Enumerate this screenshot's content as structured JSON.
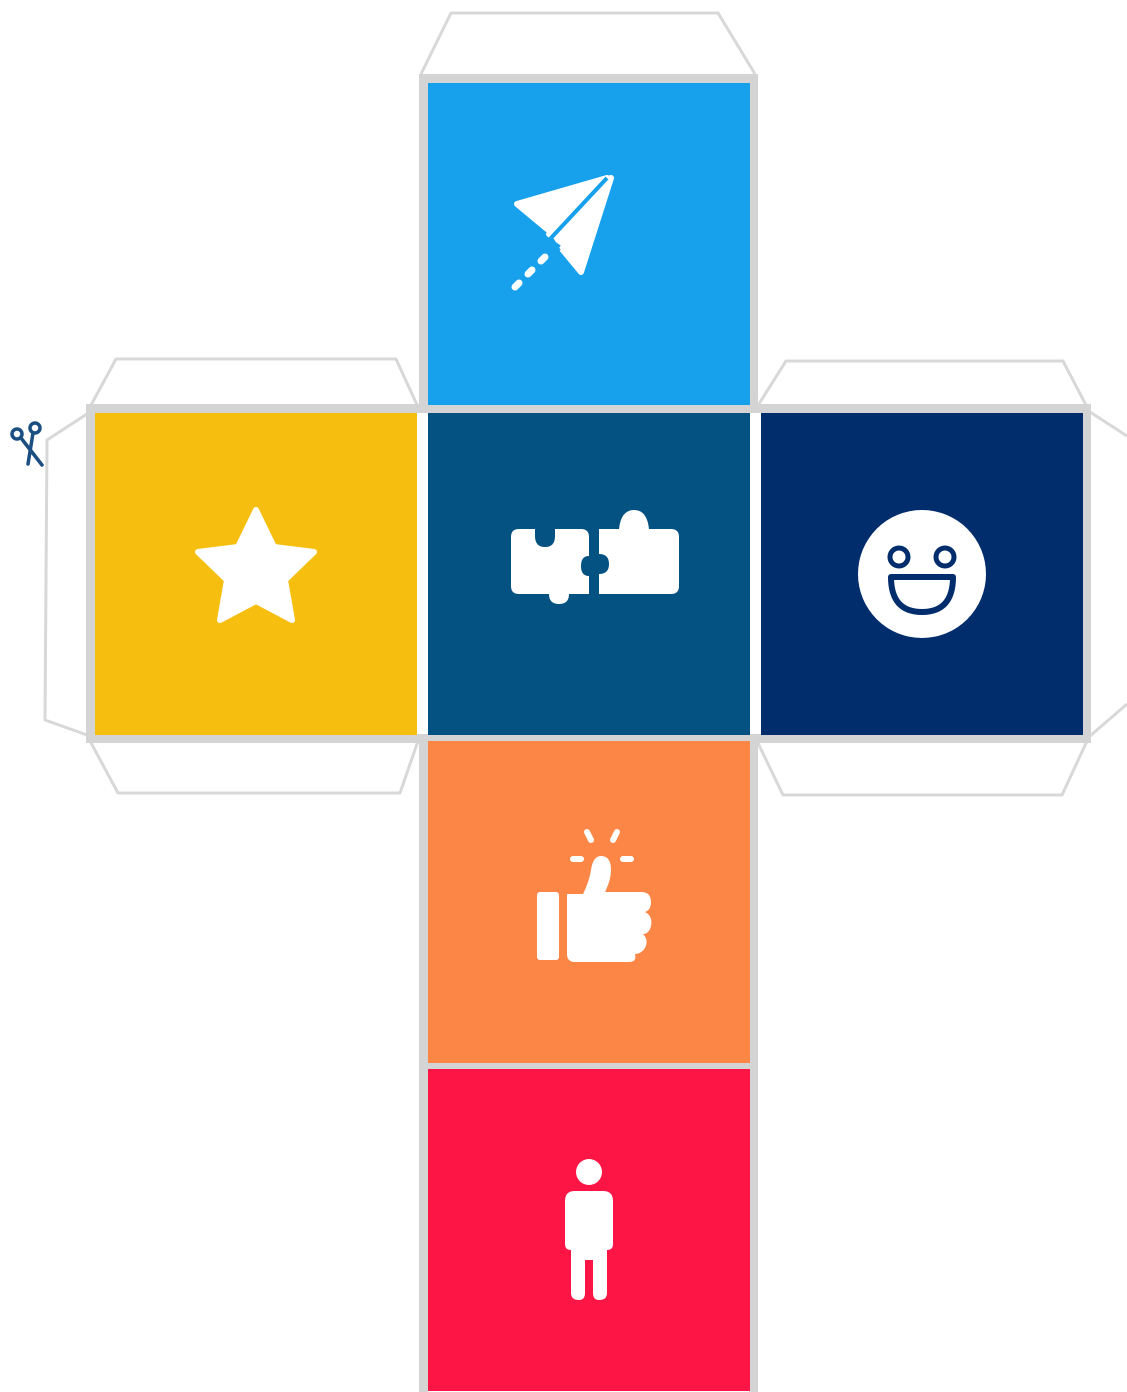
{
  "net": {
    "faces": [
      {
        "id": "top",
        "icon": "paper-plane-icon",
        "color": "#17A0EC"
      },
      {
        "id": "left",
        "icon": "star-icon",
        "color": "#F6BE0F"
      },
      {
        "id": "center",
        "icon": "puzzle-icon",
        "color": "#035282"
      },
      {
        "id": "right",
        "icon": "smiley-icon",
        "color": "#012D6C"
      },
      {
        "id": "lower",
        "icon": "thumbs-up-icon",
        "color": "#FC8646"
      },
      {
        "id": "bottom",
        "icon": "person-icon",
        "color": "#FC1545"
      }
    ],
    "outline_color": "#D4D4D4",
    "icon_color": "#FFFFFF",
    "cut_marker": {
      "icon": "scissors-icon",
      "color": "#1B4F82"
    }
  }
}
